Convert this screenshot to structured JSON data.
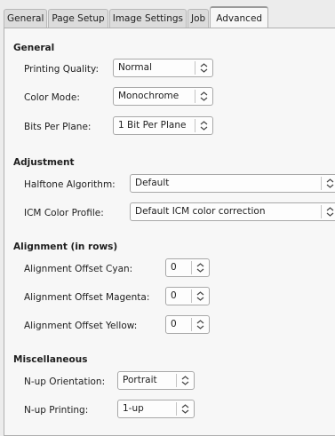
{
  "tabs": [
    "General",
    "Page Setup",
    "Image Settings",
    "Job",
    "Advanced"
  ],
  "active_tab": "Advanced",
  "general": {
    "heading": "General",
    "printing_quality": {
      "label": "Printing Quality:",
      "value": "Normal"
    },
    "color_mode": {
      "label": "Color Mode:",
      "value": "Monochrome"
    },
    "bits_per_plane": {
      "label": "Bits Per Plane:",
      "value": "1 Bit Per Plane"
    }
  },
  "adjustment": {
    "heading": "Adjustment",
    "halftone": {
      "label": "Halftone Algorithm:",
      "value": "Default"
    },
    "icm": {
      "label": "ICM Color Profile:",
      "value": "Default ICM color correction"
    }
  },
  "alignment": {
    "heading": "Alignment (in rows)",
    "cyan": {
      "label": "Alignment Offset Cyan:",
      "value": "0"
    },
    "magenta": {
      "label": "Alignment Offset Magenta:",
      "value": "0"
    },
    "yellow": {
      "label": "Alignment Offset Yellow:",
      "value": "0"
    }
  },
  "misc": {
    "heading": "Miscellaneous",
    "nup_orientation": {
      "label": "N-up Orientation:",
      "value": "Portrait"
    },
    "nup_printing": {
      "label": "N-up Printing:",
      "value": "1-up"
    }
  },
  "icons": {
    "spin": "up-down-arrows-icon"
  },
  "colors": {
    "active_tab_accent": "#5a8fd0",
    "background": "#ececec"
  }
}
